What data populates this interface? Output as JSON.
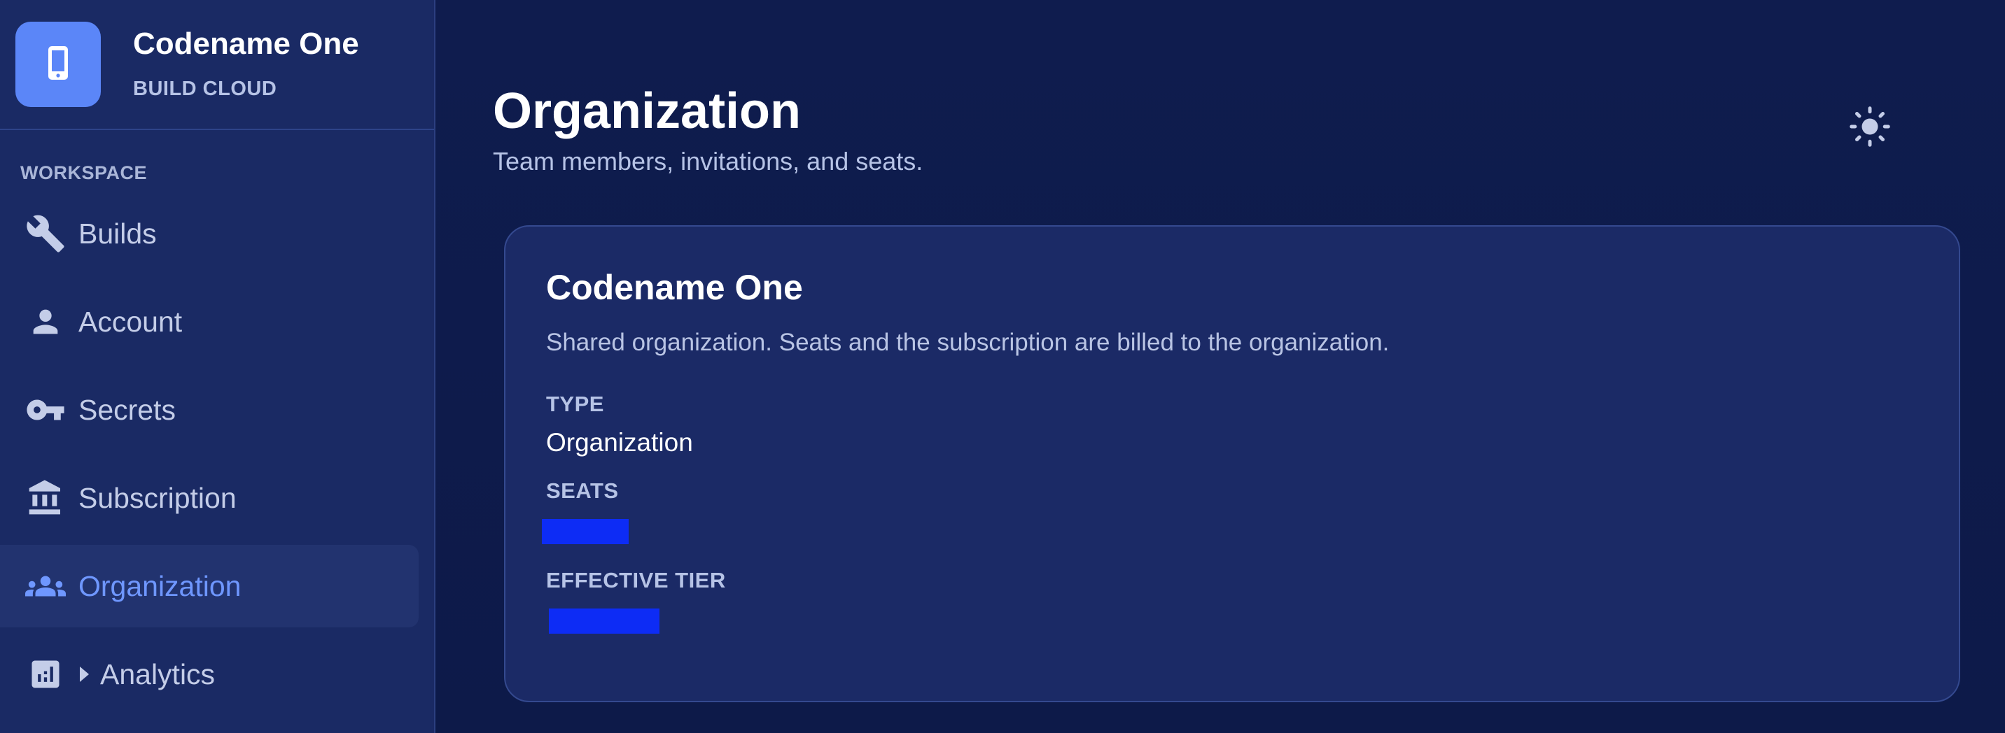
{
  "brand": {
    "name": "Codename One",
    "subtitle": "BUILD CLOUD",
    "logo_icon": "phone-icon",
    "logo_color": "#5b86f8"
  },
  "sidebar": {
    "section_label": "WORKSPACE",
    "items": [
      {
        "label": "Builds",
        "icon": "wrench-icon",
        "active": false
      },
      {
        "label": "Account",
        "icon": "person-icon",
        "active": false
      },
      {
        "label": "Secrets",
        "icon": "key-icon",
        "active": false
      },
      {
        "label": "Subscription",
        "icon": "bank-icon",
        "active": false
      },
      {
        "label": "Organization",
        "icon": "group-icon",
        "active": true
      },
      {
        "label": "Analytics",
        "icon": "bar-chart-icon",
        "active": false,
        "expandable": true
      }
    ]
  },
  "header": {
    "title": "Organization",
    "subtitle": "Team members, invitations, and seats.",
    "theme_toggle_icon": "sun-icon"
  },
  "card": {
    "title": "Codename One",
    "description": "Shared organization. Seats and the subscription are billed to the organization.",
    "fields": [
      {
        "label": "TYPE",
        "value": "Organization"
      },
      {
        "label": "SEATS",
        "value": ""
      },
      {
        "label": "EFFECTIVE TIER",
        "value": ""
      }
    ]
  },
  "colors": {
    "background": "#0f1b4c",
    "sidebar": "#1a2a64",
    "card": "#1b2a66",
    "accent": "#6f97ff",
    "redaction": "#0d2cf5"
  }
}
